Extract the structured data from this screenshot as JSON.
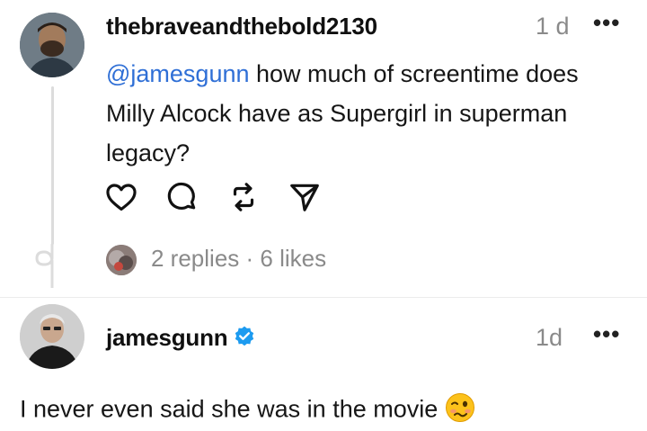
{
  "post": {
    "username": "thebraveandthebold2130",
    "time": "1 d",
    "more": "•••",
    "mention": "@jamesgunn",
    "text": " how much of screentime does Milly Alcock have as Supergirl in superman legacy?",
    "stats": "2 replies · 6 likes",
    "actions": [
      "heart-icon",
      "comment-icon",
      "repost-icon",
      "share-icon"
    ]
  },
  "reply": {
    "username": "jamesgunn",
    "verified": true,
    "time": "1d",
    "more": "•••",
    "text": "I never even said she was in the movie",
    "emoji": "woozy-face"
  },
  "colors": {
    "link": "#2f6fd6",
    "verified": "#1d9bf0",
    "muted": "#8a8a8a"
  }
}
